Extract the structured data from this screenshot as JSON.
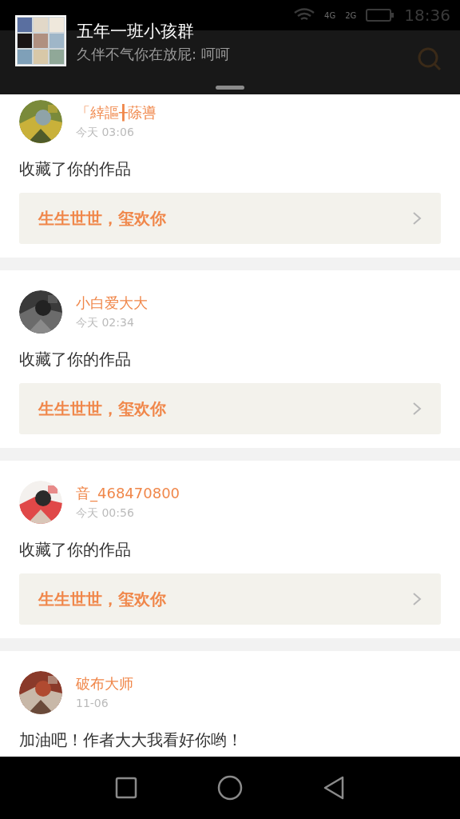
{
  "status_bar": {
    "network_labels": [
      "4G",
      "2G"
    ],
    "time": "18:36"
  },
  "notification": {
    "title": "五年一班小孩群",
    "message": "久伴不气你在放屁: 呵呵"
  },
  "messages": [
    {
      "user": "「緈謳╂蒢噵",
      "time": "今天 03:06",
      "action": "收藏了你的作品",
      "work": "生生世世，玺欢你"
    },
    {
      "user": "小白爱大大",
      "time": "今天 02:34",
      "action": "收藏了你的作品",
      "work": "生生世世，玺欢你"
    },
    {
      "user": "音_468470800",
      "time": "今天 00:56",
      "action": "收藏了你的作品",
      "work": "生生世世，玺欢你"
    },
    {
      "user": "破布大师",
      "time": "11-06",
      "action": "加油吧！作者大大我看好你哟！"
    }
  ]
}
